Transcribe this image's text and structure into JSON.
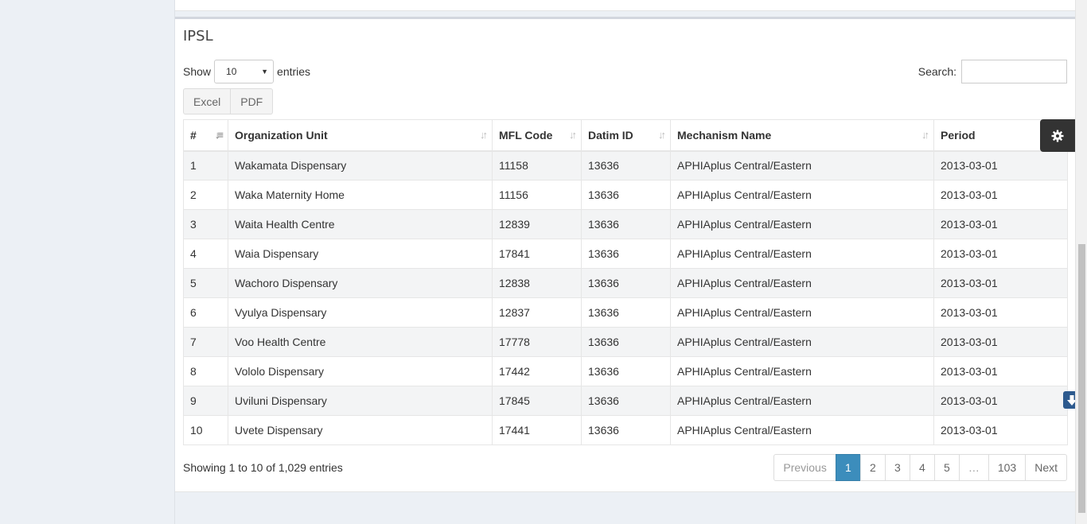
{
  "box": {
    "title": "IPSL"
  },
  "length": {
    "show_label": "Show",
    "selected": "10",
    "entries_label": "entries"
  },
  "search": {
    "label": "Search:",
    "value": ""
  },
  "export_buttons": [
    "Excel",
    "PDF"
  ],
  "table": {
    "columns": [
      "#",
      "Organization Unit",
      "MFL Code",
      "Datim ID",
      "Mechanism Name",
      "Period"
    ],
    "rows": [
      [
        "1",
        "Wakamata Dispensary",
        "11158",
        "13636",
        "APHIAplus Central/Eastern",
        "2013-03-01"
      ],
      [
        "2",
        "Waka Maternity Home",
        "11156",
        "13636",
        "APHIAplus Central/Eastern",
        "2013-03-01"
      ],
      [
        "3",
        "Waita Health Centre",
        "12839",
        "13636",
        "APHIAplus Central/Eastern",
        "2013-03-01"
      ],
      [
        "4",
        "Waia Dispensary",
        "17841",
        "13636",
        "APHIAplus Central/Eastern",
        "2013-03-01"
      ],
      [
        "5",
        "Wachoro Dispensary",
        "12838",
        "13636",
        "APHIAplus Central/Eastern",
        "2013-03-01"
      ],
      [
        "6",
        "Vyulya Dispensary",
        "12837",
        "13636",
        "APHIAplus Central/Eastern",
        "2013-03-01"
      ],
      [
        "7",
        "Voo Health Centre",
        "17778",
        "13636",
        "APHIAplus Central/Eastern",
        "2013-03-01"
      ],
      [
        "8",
        "Vololo Dispensary",
        "17442",
        "13636",
        "APHIAplus Central/Eastern",
        "2013-03-01"
      ],
      [
        "9",
        "Uviluni Dispensary",
        "17845",
        "13636",
        "APHIAplus Central/Eastern",
        "2013-03-01"
      ],
      [
        "10",
        "Uvete Dispensary",
        "17441",
        "13636",
        "APHIAplus Central/Eastern",
        "2013-03-01"
      ]
    ]
  },
  "info": "Showing 1 to 10 of 1,029 entries",
  "pagination": {
    "previous": "Previous",
    "pages": [
      "1",
      "2",
      "3",
      "4",
      "5",
      "…",
      "103"
    ],
    "active": "1",
    "next": "Next"
  },
  "icons": {
    "settings": "gear-icon",
    "scroll_down": "arrow-down-icon"
  },
  "colors": {
    "accent": "#3c8dbc",
    "settings_bg": "#333333",
    "scroll_btn": "#2d5a8e"
  }
}
